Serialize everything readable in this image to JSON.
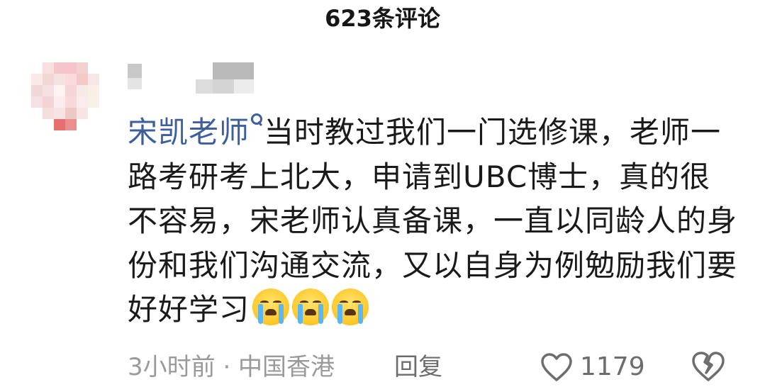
{
  "header": {
    "title": "623条评论"
  },
  "comment": {
    "mention": "宋凯老师",
    "text": "当时教过我们一门选修课，老师一路考研考上北大，申请到UBC博士，真的很不容易，宋老师认真备课，一直以同龄人的身份和我们沟通交流，又以自身为例勉励我们要好好学习",
    "emojis": [
      "loudly-crying-face",
      "loudly-crying-face",
      "loudly-crying-face"
    ],
    "meta": "3小时前 · 中国香港",
    "reply_label": "回复",
    "like_count": "1179"
  },
  "icons": {
    "mention": "search-person-icon",
    "like": "heart-outline-icon",
    "dislike": "broken-heart-icon"
  },
  "colors": {
    "mention": "#3d5f9e",
    "meta": "#9a9a9a",
    "action": "#6d6d6d"
  }
}
